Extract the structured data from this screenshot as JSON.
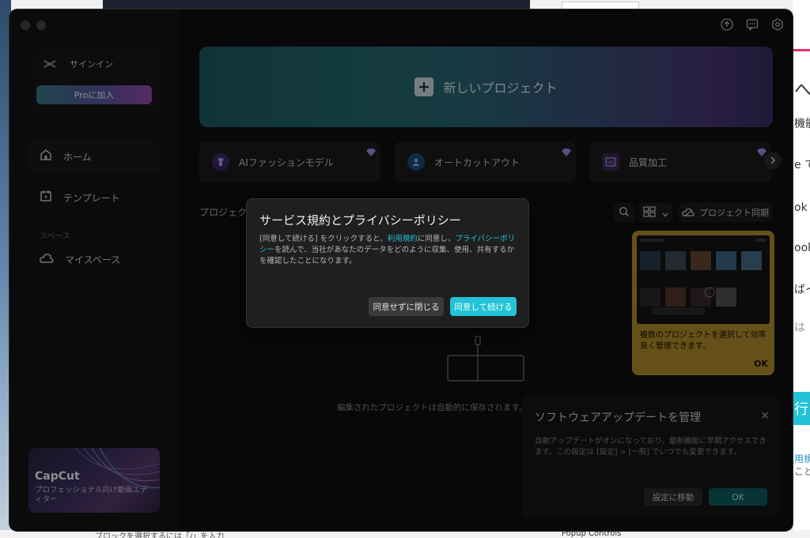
{
  "sidebar": {
    "signin_label": "サインイン",
    "pro_button": "Proに加入",
    "nav": {
      "home": "ホーム",
      "templates": "テンプレート",
      "space_section": "スペース",
      "my_space": "マイスペース"
    },
    "promo": {
      "title": "CapCut",
      "subtitle": "プロフェッショナル向け動画エディター"
    }
  },
  "main": {
    "new_project": "新しいプロジェクト",
    "tools": [
      {
        "label": "AIファッションモデル",
        "icon": "shirt-icon"
      },
      {
        "label": "オートカットアウト",
        "icon": "person-icon"
      },
      {
        "label": "品質加工",
        "icon": "hd-icon"
      }
    ],
    "projects_label": "プロジェクト",
    "sync_label": "プロジェクト同期",
    "tip": {
      "text": "複数のプロジェクトを選択して効率良く管理できます。",
      "ok": "OK"
    },
    "empty_text": "編集されたプロジェクトは自動的に保存されます。"
  },
  "update_panel": {
    "title": "ソフトウェアアップデートを管理",
    "close": "×",
    "body": "自動アップデートがオンになっており、最新機能に早期アクセスできます。この設定は [設定] > [一般] でいつでも変更できます。",
    "settings_button": "設定に移動",
    "ok_button": "OK"
  },
  "modal": {
    "title": "サービス規約とプライバシーポリシー",
    "body_1": "[同意して続ける] をクリックすると、",
    "link_terms": "利用規約",
    "body_2": "に同意し、",
    "link_privacy": "プライバシーポリシー",
    "body_3": "を読んで、当社があなたのデータをどのように収集、使用、共有するかを確認したことになります。",
    "decline_button": "同意せずに閉じる",
    "accept_button": "同意して続ける"
  },
  "background": {
    "right_texts": [
      "へ",
      "機能",
      "e て",
      "ok て",
      "ook",
      "ばイ",
      "は",
      "行",
      "用規",
      "こと"
    ],
    "bottom_left_text": "ブロックを選択するには「/」を入力",
    "bottom_right_text": "Popup Controls"
  },
  "colors": {
    "accent": "#22c3d6",
    "tip": "#b8922f",
    "pro_gradient_start": "#3a7f86",
    "pro_gradient_end": "#9b4fb0"
  }
}
